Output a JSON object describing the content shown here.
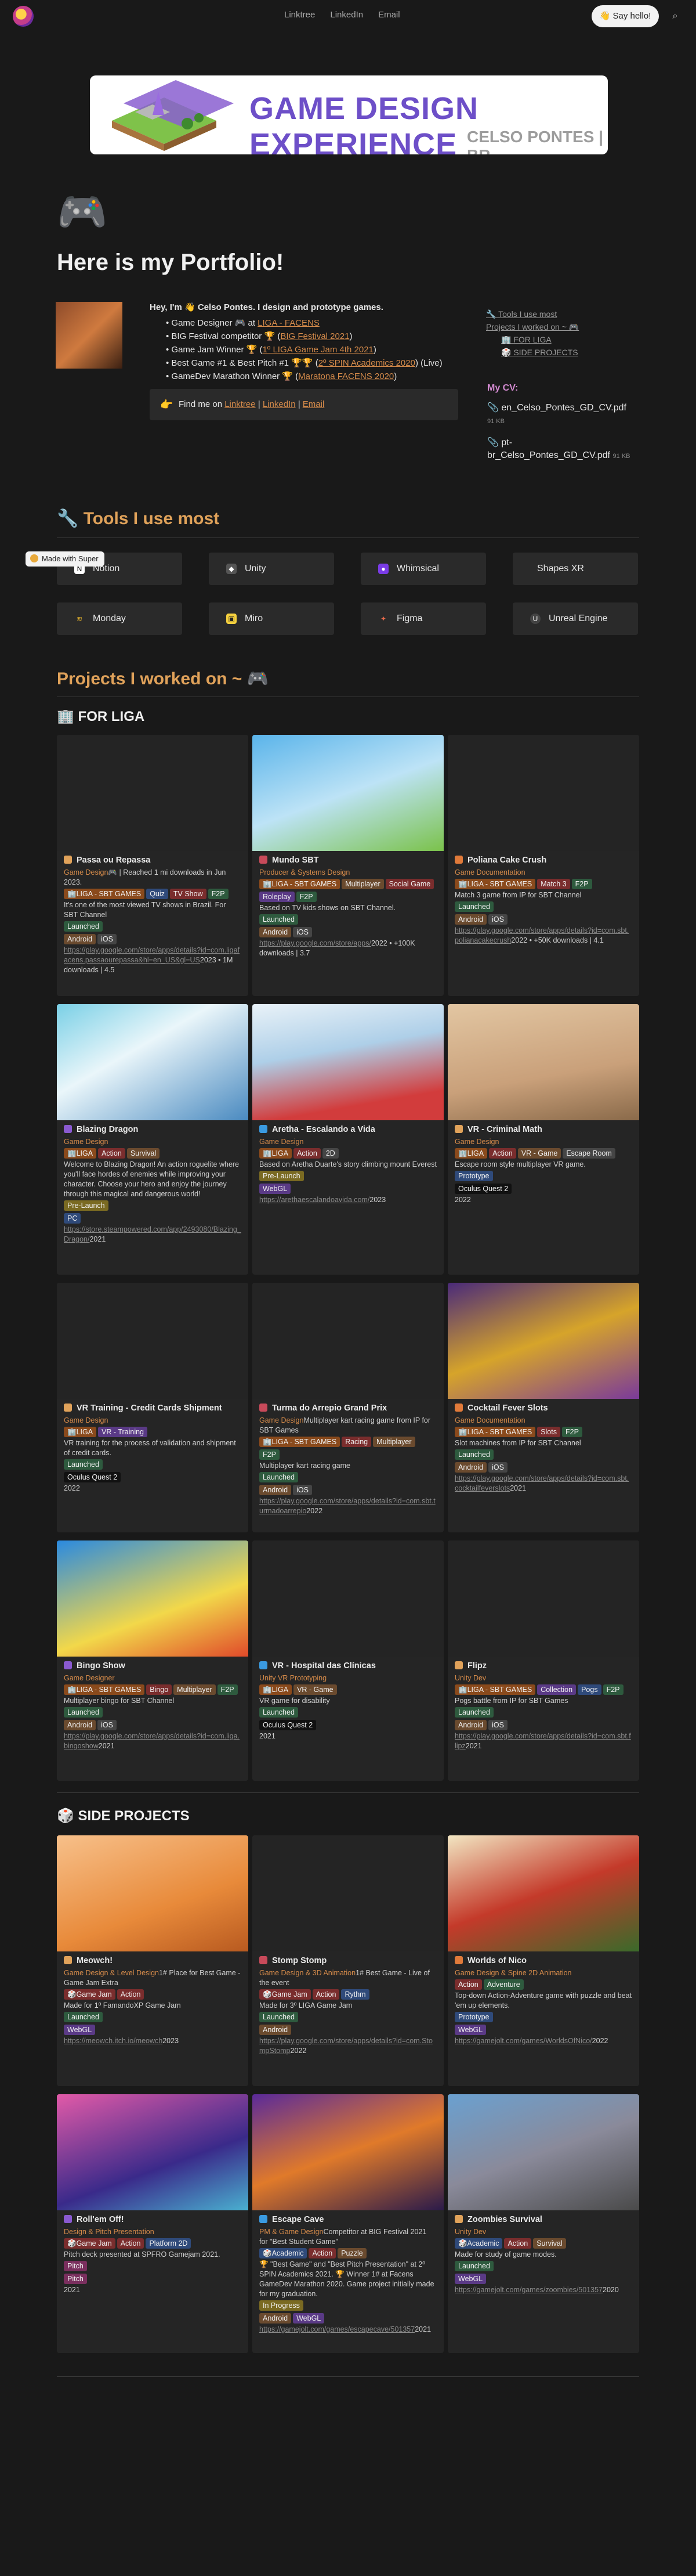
{
  "nav": {
    "links": [
      "Linktree",
      "LinkedIn",
      "Email"
    ],
    "say_hello": "👋 Say hello!"
  },
  "made_with": "Made with Super",
  "banner": {
    "title": "GAME DESIGN EXPERIENCE",
    "subtitle": "CELSO PONTES | BR"
  },
  "hero": {
    "icon": "🎮",
    "heading": "Here is my Portfolio!"
  },
  "intro": {
    "hey": "Hey, I'm 👋 Celso Pontes. I design and prototype games.",
    "bullets": [
      {
        "pre": "Game Designer 🎮 at ",
        "link": "LIGA - FACENS",
        "post": ""
      },
      {
        "pre": "BIG Festival competitor 🏆 (",
        "link": "BIG Festival 2021",
        "post": ")"
      },
      {
        "pre": "Game Jam Winner 🏆 (",
        "link": "1º LIGA Game Jam 4th 2021",
        "post": ")"
      },
      {
        "pre": "Best Game #1 & Best Pitch #1 🏆🏆 (",
        "link": "2º SPIN Academics 2020",
        "post": ") (Live)"
      },
      {
        "pre": "GameDev Marathon Winner 🏆 (",
        "link": "Maratona FACENS 2020",
        "post": ")"
      }
    ],
    "findme": {
      "pre": "Find me on ",
      "l1": "Linktree",
      "sep1": " | ",
      "l2": "LinkedIn",
      "sep2": " | ",
      "l3": "Email",
      "icon": "👉"
    }
  },
  "toc": [
    "🔧 Tools I use most",
    "Projects I worked on ~ 🎮",
    "🏢 FOR LIGA",
    "🎲 SIDE PROJECTS"
  ],
  "cv": {
    "heading": "My CV:",
    "files": [
      {
        "name": "en_Celso_Pontes_GD_CV.pdf",
        "size": "91 KB"
      },
      {
        "name": "pt-br_Celso_Pontes_GD_CV.pdf",
        "size": "91 KB"
      }
    ]
  },
  "tools": {
    "title": "🔧 Tools I use most",
    "items": [
      "Notion",
      "Unity",
      "Whimsical",
      "Shapes XR",
      "Monday",
      "Miro",
      "Figma",
      "Unreal Engine"
    ]
  },
  "projects_title": "Projects I worked on ~ 🎮",
  "liga_title": "🏢 FOR LIGA",
  "side_title": "🎲 SIDE PROJECTS",
  "liga_cards": [
    {
      "name": "Passa ou Repassa",
      "role": "Game Design🎮",
      "desc": " | Reached 1 mi downloads in Jun 2023.",
      "tags": [
        [
          "🏢LIGA - SBT GAMES",
          "t-org"
        ],
        [
          "Quiz",
          "t-blue"
        ],
        [
          "TV Show",
          "t-red"
        ],
        [
          "F2P",
          "t-green"
        ]
      ],
      "text": "It's one of the most viewed TV shows in Brazil. For SBT Channel",
      "status": [
        "Launched",
        "t-green"
      ],
      "plat": [
        [
          "Android",
          "t-brown"
        ],
        [
          "iOS",
          "t-gray"
        ]
      ],
      "url": "https://play.google.com/store/apps/details?id=com.ligafacens.passaourepassa&hl=en_US&gl=US",
      "extra": "2023 • 1M downloads | 4.5"
    },
    {
      "name": "Mundo SBT",
      "role": "Producer & Systems Design",
      "desc": "",
      "tags": [
        [
          "🏢LIGA - SBT GAMES",
          "t-org"
        ],
        [
          "Multiplayer",
          "t-brown"
        ],
        [
          "Social Game",
          "t-red"
        ],
        [
          "Roleplay",
          "t-purple"
        ],
        [
          "F2P",
          "t-green"
        ]
      ],
      "text": "Based on TV kids shows on SBT Channel.",
      "status": [
        "Launched",
        "t-green"
      ],
      "plat": [
        [
          "Android",
          "t-brown"
        ],
        [
          "iOS",
          "t-gray"
        ]
      ],
      "url": "https://play.google.com/store/apps/",
      "extra": "2022 • +100K downloads | 3.7"
    },
    {
      "name": "Poliana Cake Crush",
      "role": "Game Documentation",
      "desc": "",
      "tags": [
        [
          "🏢LIGA - SBT GAMES",
          "t-org"
        ],
        [
          "Match 3",
          "t-red"
        ],
        [
          "F2P",
          "t-green"
        ]
      ],
      "text": "Match 3 game from IP for SBT Channel",
      "status": [
        "Launched",
        "t-green"
      ],
      "plat": [
        [
          "Android",
          "t-brown"
        ],
        [
          "iOS",
          "t-gray"
        ]
      ],
      "url": "https://play.google.com/store/apps/details?id=com.sbt.polianacakecrush",
      "extra": "2022 • +50K downloads | 4.1"
    },
    {
      "name": "Blazing Dragon",
      "role": "Game Design",
      "desc": "",
      "tags": [
        [
          "🏢LIGA",
          "t-org"
        ],
        [
          "Action",
          "t-red"
        ],
        [
          "Survival",
          "t-brown"
        ]
      ],
      "text": "Welcome to Blazing Dragon! An action roguelite where you'll face hordes of enemies while improving your character. Choose your hero and enjoy the journey through this magical and dangerous world!",
      "status": [
        "Pre-Launch",
        "t-yel"
      ],
      "plat": [
        [
          "PC",
          "t-blue"
        ]
      ],
      "url": "https://store.steampowered.com/app/2493080/Blazing_Dragon/",
      "extra": "2021"
    },
    {
      "name": "Aretha - Escalando a Vida",
      "role": "Game Design",
      "desc": "",
      "tags": [
        [
          "🏢LIGA",
          "t-org"
        ],
        [
          "Action",
          "t-red"
        ],
        [
          "2D",
          "t-gray"
        ]
      ],
      "text": "Based on Aretha Duarte's story climbing mount Everest",
      "status": [
        "Pre-Launch",
        "t-yel"
      ],
      "plat": [
        [
          "WebGL",
          "t-purple"
        ]
      ],
      "url": "https://arethaescalandoavida.com/",
      "extra": "2023"
    },
    {
      "name": "VR - Criminal Math",
      "role": "Game Design",
      "desc": "",
      "tags": [
        [
          "🏢LIGA",
          "t-org"
        ],
        [
          "Action",
          "t-red"
        ],
        [
          "VR - Game",
          "t-brown"
        ],
        [
          "Escape Room",
          "t-gray"
        ]
      ],
      "text": "Escape room style multiplayer VR game.",
      "status": [
        "Prototype",
        "t-blue"
      ],
      "plat": [
        [
          "Oculus Quest 2",
          "t-black"
        ]
      ],
      "url": "",
      "extra": "2022"
    },
    {
      "name": "VR Training - Credit Cards Shipment",
      "role": "Game Design",
      "desc": "",
      "tags": [
        [
          "🏢LIGA",
          "t-org"
        ],
        [
          "VR - Training",
          "t-purple"
        ]
      ],
      "text": "VR training for the process of validation and shipment of credit cards.",
      "status": [
        "Launched",
        "t-green"
      ],
      "plat": [
        [
          "Oculus Quest 2",
          "t-black"
        ]
      ],
      "url": "",
      "extra": "2022"
    },
    {
      "name": "Turma do Arrepio Grand Prix",
      "role": "Game Design",
      "desc": "Multiplayer kart racing game from IP for SBT Games",
      "tags": [
        [
          "🏢LIGA - SBT GAMES",
          "t-org"
        ],
        [
          "Racing",
          "t-red"
        ],
        [
          "Multiplayer",
          "t-brown"
        ],
        [
          "F2P",
          "t-green"
        ]
      ],
      "text": "Multiplayer kart racing game",
      "status": [
        "Launched",
        "t-green"
      ],
      "plat": [
        [
          "Android",
          "t-brown"
        ],
        [
          "iOS",
          "t-gray"
        ]
      ],
      "url": "https://play.google.com/store/apps/details?id=com.sbt.turmadoarrepio",
      "extra": "2022"
    },
    {
      "name": "Cocktail Fever Slots",
      "role": "Game Documentation",
      "desc": "",
      "tags": [
        [
          "🏢LIGA - SBT GAMES",
          "t-org"
        ],
        [
          "Slots",
          "t-red"
        ],
        [
          "F2P",
          "t-green"
        ]
      ],
      "text": "Slot machines from IP for SBT Channel",
      "status": [
        "Launched",
        "t-green"
      ],
      "plat": [
        [
          "Android",
          "t-brown"
        ],
        [
          "iOS",
          "t-gray"
        ]
      ],
      "url": "https://play.google.com/store/apps/details?id=com.sbt.cocktailfeverslots",
      "extra": "2021"
    },
    {
      "name": "Bingo Show",
      "role": "Game Designer",
      "desc": "",
      "tags": [
        [
          "🏢LIGA - SBT GAMES",
          "t-org"
        ],
        [
          "Bingo",
          "t-red"
        ],
        [
          "Multiplayer",
          "t-brown"
        ],
        [
          "F2P",
          "t-green"
        ]
      ],
      "text": "Multiplayer bingo for SBT Channel",
      "status": [
        "Launched",
        "t-green"
      ],
      "plat": [
        [
          "Android",
          "t-brown"
        ],
        [
          "iOS",
          "t-gray"
        ]
      ],
      "url": "https://play.google.com/store/apps/details?id=com.liga.bingoshow",
      "extra": "2021"
    },
    {
      "name": "VR - Hospital das Clínicas",
      "role": "Unity VR Prototyping",
      "desc": "",
      "tags": [
        [
          "🏢LIGA",
          "t-org"
        ],
        [
          "VR - Game",
          "t-brown"
        ]
      ],
      "text": "VR game for disability",
      "status": [
        "Launched",
        "t-green"
      ],
      "plat": [
        [
          "Oculus Quest 2",
          "t-black"
        ]
      ],
      "url": "",
      "extra": "2021"
    },
    {
      "name": "Flipz",
      "role": "Unity Dev",
      "desc": "",
      "tags": [
        [
          "🏢LIGA - SBT GAMES",
          "t-org"
        ],
        [
          "Collection",
          "t-purple"
        ],
        [
          "Pogs",
          "t-blue"
        ],
        [
          "F2P",
          "t-green"
        ]
      ],
      "text": "Pogs battle from IP for SBT Games",
      "status": [
        "Launched",
        "t-green"
      ],
      "plat": [
        [
          "Android",
          "t-brown"
        ],
        [
          "iOS",
          "t-gray"
        ]
      ],
      "url": "https://play.google.com/store/apps/details?id=com.sbt.flipz",
      "extra": "2021"
    }
  ],
  "side_cards": [
    {
      "name": "Meowch!",
      "role": "Game Design & Level Design",
      "desc": "1# Place for Best Game - Game Jam Extra",
      "tags": [
        [
          "🎲Game Jam",
          "t-red"
        ],
        [
          "Action",
          "t-red"
        ]
      ],
      "text": "Made for 1º FamandoXP Game Jam",
      "status": [
        "Launched",
        "t-green"
      ],
      "plat": [
        [
          "WebGL",
          "t-purple"
        ]
      ],
      "url": "https://meowch.itch.io/meowch",
      "extra": "2023"
    },
    {
      "name": "Stomp Stomp",
      "role": "Game Design & 3D Animation",
      "desc": "1# Best Game - Live of the event",
      "tags": [
        [
          "🎲Game Jam",
          "t-red"
        ],
        [
          "Action",
          "t-red"
        ],
        [
          "Rythm",
          "t-blue"
        ]
      ],
      "text": "Made for 3º LIGA Game Jam",
      "status": [
        "Launched",
        "t-green"
      ],
      "plat": [
        [
          "Android",
          "t-brown"
        ]
      ],
      "url": "https://play.google.com/store/apps/details?id=com.StompStomp",
      "extra": "2022"
    },
    {
      "name": "Worlds of Nico",
      "role": "Game Design & Spine 2D Animation",
      "desc": "",
      "tags": [
        [
          "Action",
          "t-red"
        ],
        [
          "Adventure",
          "t-green"
        ]
      ],
      "text": "Top-down Action-Adventure game with puzzle and beat 'em up elements.",
      "status": [
        "Prototype",
        "t-blue"
      ],
      "plat": [
        [
          "WebGL",
          "t-purple"
        ]
      ],
      "url": "https://gamejolt.com/games/WorldsOfNico/",
      "extra": "2022"
    },
    {
      "name": "Roll'em Off!",
      "role": "Design & Pitch Presentation",
      "desc": "",
      "tags": [
        [
          "🎲Game Jam",
          "t-red"
        ],
        [
          "Action",
          "t-red"
        ],
        [
          "Platform 2D",
          "t-blue"
        ]
      ],
      "text": "Pitch deck presented at SPFRO Gamejam 2021.",
      "status": [
        "Pitch",
        "t-pink"
      ],
      "plat": [
        [
          "Pitch",
          "t-pink"
        ]
      ],
      "url": "",
      "extra": "2021"
    },
    {
      "name": "Escape Cave",
      "role": "PM & Game Design",
      "desc": "Competitor at BIG Festival 2021 for \"Best Student Game\"",
      "tags": [
        [
          "🎲Academic",
          "t-blue"
        ],
        [
          "Action",
          "t-red"
        ],
        [
          "Puzzle",
          "t-brown"
        ]
      ],
      "text": "🏆 \"Best Game\" and \"Best Pitch Presentation\" at 2º SPIN Academics 2021. 🏆 Winner 1# at Facens GameDev Marathon 2020. Game project initially made for my graduation.",
      "status": [
        "In Progress",
        "t-yel"
      ],
      "plat": [
        [
          "Android",
          "t-brown"
        ],
        [
          "WebGL",
          "t-purple"
        ]
      ],
      "url": "https://gamejolt.com/games/escapecave/501357",
      "extra": "2021"
    },
    {
      "name": "Zoombies Survival",
      "role": "Unity Dev",
      "desc": "",
      "tags": [
        [
          "🎲Academic",
          "t-blue"
        ],
        [
          "Action",
          "t-red"
        ],
        [
          "Survival",
          "t-brown"
        ]
      ],
      "text": "Made for study of game modes.",
      "status": [
        "Launched",
        "t-green"
      ],
      "plat": [
        [
          "WebGL",
          "t-purple"
        ]
      ],
      "url": "https://gamejolt.com/games/zoombies/501357",
      "extra": "2020"
    }
  ]
}
